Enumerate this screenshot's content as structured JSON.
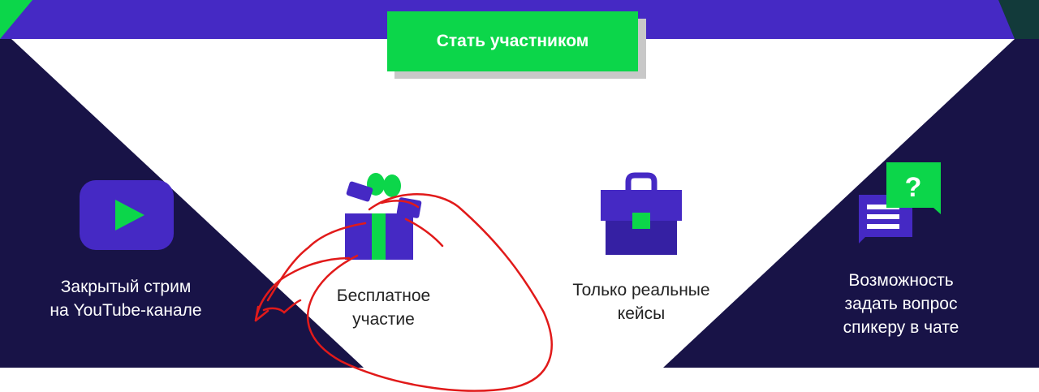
{
  "cta": {
    "label": "Стать участником"
  },
  "colors": {
    "navy": "#181347",
    "purple": "#4529c4",
    "green": "#0cd64a",
    "annotation": "#e11a1a"
  },
  "features": [
    {
      "icon": "youtube-play-icon",
      "line1": "Закрытый стрим",
      "line2": "на YouTube-канале"
    },
    {
      "icon": "gift-icon",
      "line1": "Бесплатное",
      "line2": "участие"
    },
    {
      "icon": "briefcase-icon",
      "line1": "Только реальные",
      "line2": "кейсы"
    },
    {
      "icon": "chat-question-icon",
      "line1": "Возможность",
      "line2": "задать вопрос",
      "line3": "спикеру в чате"
    }
  ]
}
